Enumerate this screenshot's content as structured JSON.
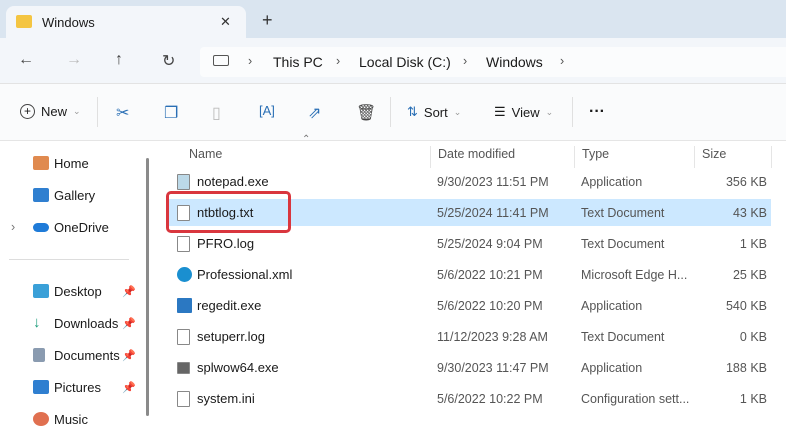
{
  "tab": {
    "title": "Windows",
    "close": "✕",
    "new_tab": "+"
  },
  "nav": {
    "back": "←",
    "forward": "→",
    "up": "↑",
    "refresh": "↻"
  },
  "breadcrumb": [
    "This PC",
    "Local Disk (C:)",
    "Windows"
  ],
  "toolbar": {
    "new_label": "New",
    "sort_label": "Sort",
    "view_label": "View",
    "more": "···"
  },
  "sidebar": {
    "items": [
      {
        "label": "Home"
      },
      {
        "label": "Gallery"
      },
      {
        "label": "OneDrive"
      }
    ],
    "pinned": [
      {
        "label": "Desktop"
      },
      {
        "label": "Downloads"
      },
      {
        "label": "Documents"
      },
      {
        "label": "Pictures"
      },
      {
        "label": "Music"
      }
    ]
  },
  "columns": [
    "Name",
    "Date modified",
    "Type",
    "Size"
  ],
  "files": [
    {
      "name": "notepad.exe",
      "date": "9/30/2023 11:51 PM",
      "type": "Application",
      "size": "356 KB"
    },
    {
      "name": "ntbtlog.txt",
      "date": "5/25/2024 11:41 PM",
      "type": "Text Document",
      "size": "43 KB"
    },
    {
      "name": "PFRO.log",
      "date": "5/25/2024 9:04 PM",
      "type": "Text Document",
      "size": "1 KB"
    },
    {
      "name": "Professional.xml",
      "date": "5/6/2022 10:21 PM",
      "type": "Microsoft Edge H...",
      "size": "25 KB"
    },
    {
      "name": "regedit.exe",
      "date": "5/6/2022 10:20 PM",
      "type": "Application",
      "size": "540 KB"
    },
    {
      "name": "setuperr.log",
      "date": "11/12/2023 9:28 AM",
      "type": "Text Document",
      "size": "0 KB"
    },
    {
      "name": "splwow64.exe",
      "date": "9/30/2023 11:47 PM",
      "type": "Application",
      "size": "188 KB"
    },
    {
      "name": "system.ini",
      "date": "5/6/2022 10:22 PM",
      "type": "Configuration sett...",
      "size": "1 KB"
    }
  ],
  "colors": {
    "selected": "#cce8ff",
    "highlight": "#d9363e"
  }
}
